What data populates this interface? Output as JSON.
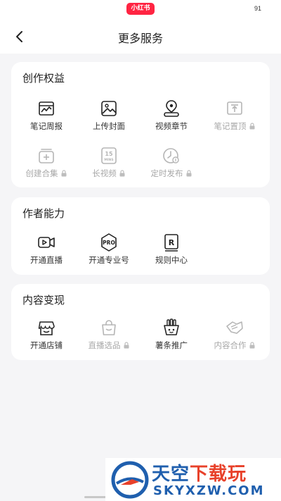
{
  "status_bar": {
    "app_badge": "小红书",
    "battery": "91"
  },
  "header": {
    "title": "更多服务"
  },
  "sections": [
    {
      "title": "创作权益",
      "items": [
        {
          "label": "笔记周报",
          "icon": "report-icon",
          "locked": false
        },
        {
          "label": "上传封面",
          "icon": "image-upload-icon",
          "locked": false
        },
        {
          "label": "视频章节",
          "icon": "video-chapter-icon",
          "locked": false
        },
        {
          "label": "笔记置顶",
          "icon": "pin-top-icon",
          "locked": true
        },
        {
          "label": "创建合集",
          "icon": "collection-icon",
          "locked": true
        },
        {
          "label": "长视频",
          "icon": "long-video-icon",
          "locked": true,
          "icon_text": "15\nMINS"
        },
        {
          "label": "定时发布",
          "icon": "scheduled-publish-icon",
          "locked": true
        }
      ]
    },
    {
      "title": "作者能力",
      "items": [
        {
          "label": "开通直播",
          "icon": "live-icon",
          "locked": false
        },
        {
          "label": "开通专业号",
          "icon": "pro-account-icon",
          "locked": false,
          "icon_text": "PRO"
        },
        {
          "label": "规则中心",
          "icon": "rules-icon",
          "locked": false,
          "icon_text": "R"
        }
      ]
    },
    {
      "title": "内容变现",
      "items": [
        {
          "label": "开通店铺",
          "icon": "shop-icon",
          "locked": false
        },
        {
          "label": "直播选品",
          "icon": "shopping-bag-icon",
          "locked": true
        },
        {
          "label": "薯条推广",
          "icon": "fries-promo-icon",
          "locked": false
        },
        {
          "label": "内容合作",
          "icon": "cooperation-icon",
          "locked": true
        }
      ]
    }
  ],
  "watermark": {
    "main_left": "天空",
    "main_right": "下载玩",
    "sub": "SKYXZW.COM"
  },
  "colors": {
    "brand_red": "#ff2442",
    "disabled": "#a8a8a8",
    "watermark_blue": "#1f5fae",
    "watermark_red": "#e8412a"
  }
}
